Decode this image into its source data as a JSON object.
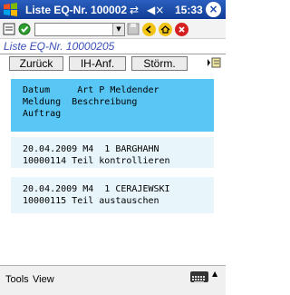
{
  "titlebar": {
    "title": "Liste EQ-Nr. 100002",
    "clock": "15:33"
  },
  "toolbar": {
    "dropdown_value": ""
  },
  "subtitle": "Liste EQ-Nr. 10000205",
  "buttons": {
    "back": "Zurück",
    "ih_request": "IH-Anf.",
    "cancel_report": "Störm."
  },
  "table": {
    "header_line1": "Datum     Art P Meldender",
    "header_line2": "Meldung  Beschreibung",
    "header_line3": "Auftrag",
    "rows": [
      {
        "line1": "20.04.2009 M4  1 BARGHAHN",
        "line2": "10000114 Teil kontrollieren"
      },
      {
        "line1": "20.04.2009 M4  1 CERAJEWSKI",
        "line2": "10000115 Teil austauschen"
      }
    ]
  },
  "bottom": {
    "tools": "Tools",
    "view": "View"
  }
}
